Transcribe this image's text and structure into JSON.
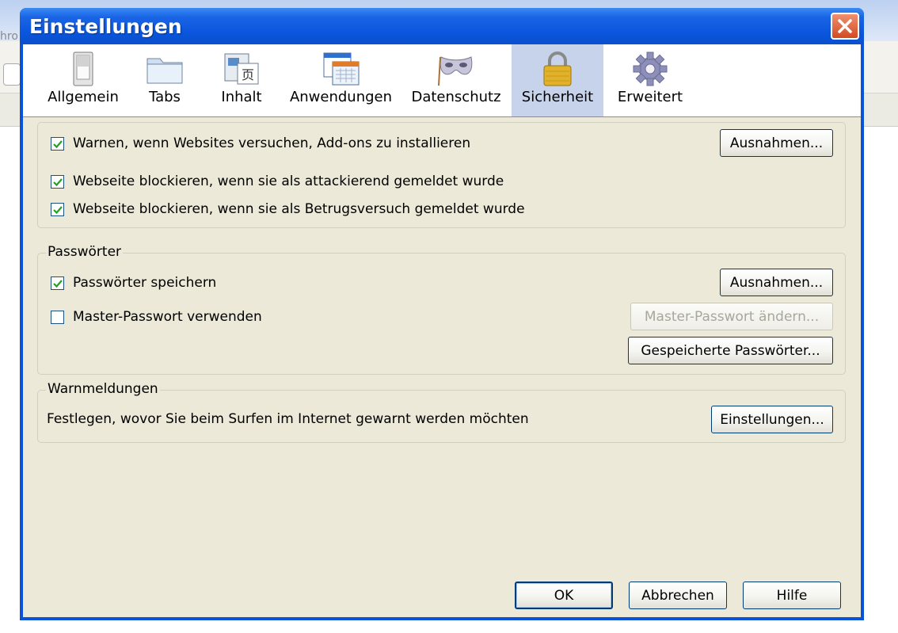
{
  "background_window": {
    "title_fragment": "hro"
  },
  "dialog": {
    "title": "Einstellungen",
    "panes": [
      {
        "label": "Allgemein",
        "icon": "switch-icon",
        "selected": false
      },
      {
        "label": "Tabs",
        "icon": "folder-tabs-icon",
        "selected": false
      },
      {
        "label": "Inhalt",
        "icon": "content-page-icon",
        "selected": false
      },
      {
        "label": "Anwendungen",
        "icon": "applications-window-icon",
        "selected": false
      },
      {
        "label": "Datenschutz",
        "icon": "privacy-mask-icon",
        "selected": false
      },
      {
        "label": "Sicherheit",
        "icon": "padlock-icon",
        "selected": true
      },
      {
        "label": "Erweitert",
        "icon": "gear-icon",
        "selected": false
      }
    ]
  },
  "security": {
    "addons": {
      "label": "Warnen, wenn Websites versuchen, Add-ons zu installieren",
      "checked": true,
      "exceptions_label": "Ausnahmen..."
    },
    "block_attack": {
      "label": "Webseite blockieren, wenn sie als attackierend gemeldet wurde",
      "checked": true
    },
    "block_forgery": {
      "label": "Webseite blockieren, wenn sie als Betrugsversuch gemeldet wurde",
      "checked": true
    }
  },
  "passwords": {
    "legend": "Passwörter",
    "save": {
      "label": "Passwörter speichern",
      "checked": true
    },
    "exceptions_label": "Ausnahmen...",
    "master": {
      "label": "Master-Passwort verwenden",
      "checked": false
    },
    "change_master_label": "Master-Passwort ändern...",
    "saved_passwords_label": "Gespeicherte Passwörter..."
  },
  "warnings": {
    "legend": "Warnmeldungen",
    "description": "Festlegen, wovor Sie beim Surfen im Internet gewarnt werden möchten",
    "settings_label": "Einstellungen..."
  },
  "footer": {
    "ok_label": "OK",
    "cancel_label": "Abbrechen",
    "help_label": "Hilfe"
  },
  "colors": {
    "title_bar": "#0a55dc",
    "dialog_bg": "#ece9d8",
    "selected_pane": "#c6d3ea",
    "check_mark": "#21a121"
  }
}
